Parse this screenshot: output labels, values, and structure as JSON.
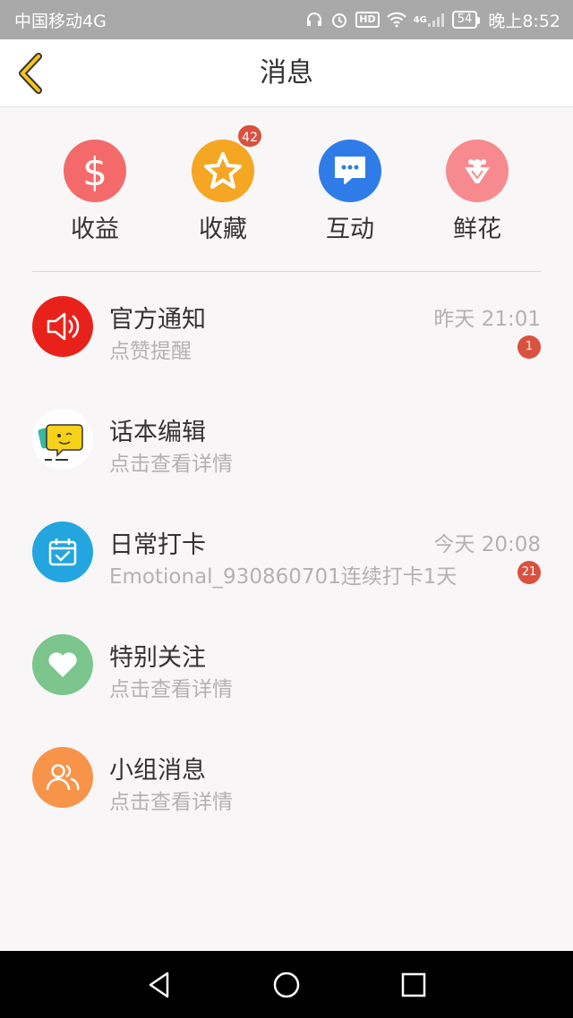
{
  "status_bar": {
    "carrier": "中国移动4G",
    "network_badge": "HD",
    "signal_label": "4G",
    "battery": "54",
    "time": "晚上8:52",
    "icons": [
      "headphones-icon",
      "alarm-icon",
      "hd-icon",
      "wifi-icon",
      "signal-icon",
      "battery-icon"
    ]
  },
  "header": {
    "title": "消息",
    "back_icon": "chevron-left-icon",
    "accent_color": "#f5a623"
  },
  "quick_entries": [
    {
      "label": "收益",
      "icon": "dollar-icon",
      "color": "#f46a6a",
      "badge": ""
    },
    {
      "label": "收藏",
      "icon": "star-icon",
      "color": "#f5a623",
      "badge": "42"
    },
    {
      "label": "互动",
      "icon": "chat-bubble-icon",
      "color": "#2f7ce8",
      "badge": ""
    },
    {
      "label": "鲜花",
      "icon": "flower-bouquet-icon",
      "color": "#f78a8e",
      "badge": ""
    }
  ],
  "messages": [
    {
      "title": "官方通知",
      "subtitle": "点赞提醒",
      "time": "昨天 21:01",
      "badge": "1",
      "icon": "speaker-icon",
      "color": "#e8221b"
    },
    {
      "title": "话本编辑",
      "subtitle": "点击查看详情",
      "time": "",
      "badge": "",
      "icon": "emoji-avatar-icon",
      "color": "#ffffff"
    },
    {
      "title": "日常打卡",
      "subtitle": "Emotional_930860701连续打卡1天",
      "time": "今天 20:08",
      "badge": "21",
      "icon": "calendar-check-icon",
      "color": "#23a5e0"
    },
    {
      "title": "特别关注",
      "subtitle": "点击查看详情",
      "time": "",
      "badge": "",
      "icon": "heart-icon",
      "color": "#7cc58d"
    },
    {
      "title": "小组消息",
      "subtitle": "点击查看详情",
      "time": "",
      "badge": "",
      "icon": "group-icon",
      "color": "#f7944a"
    }
  ],
  "nav_bar": {
    "buttons": [
      "back-triangle-icon",
      "home-circle-icon",
      "recents-square-icon"
    ]
  }
}
